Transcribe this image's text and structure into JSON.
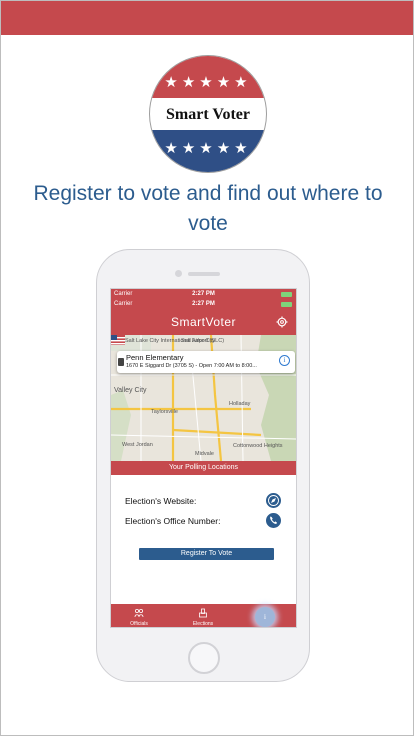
{
  "logo": {
    "wordmark": "Smart Voter",
    "stars_top": "★★★★★",
    "stars_bottom": "★★★★★"
  },
  "tagline": "Register to vote and find out where to vote",
  "device": {
    "status_bar_1": {
      "carrier": "Carrier",
      "time": "2:27 PM"
    },
    "status_bar_2": {
      "carrier": "Carrier",
      "time": "2:27 PM"
    },
    "app_title": "SmartVoter",
    "map": {
      "places": [
        "Salt Lake City",
        "Salt Lake City International Airport (SLC)",
        "Valley City",
        "Taylorsville",
        "Holladay",
        "West Jordan",
        "Cottonwood Heights",
        "Midvale"
      ],
      "callout": {
        "name": "Penn Elementary",
        "address": "1670 E Siggard Dr (3705 S) - Open 7:00 AM to 8:00..."
      }
    },
    "polling_label": "Your Polling Locations",
    "election_website_label": "Election's Website:",
    "election_office_label": "Election's Office Number:",
    "register_button": "Register To Vote",
    "tabs": [
      {
        "label": "Officials",
        "icon": "officials-icon"
      },
      {
        "label": "Elections",
        "icon": "elections-icon"
      },
      {
        "label": "",
        "icon": "info-icon"
      }
    ]
  },
  "colors": {
    "accent_red": "#c5494d",
    "accent_blue": "#2c5c8e"
  }
}
